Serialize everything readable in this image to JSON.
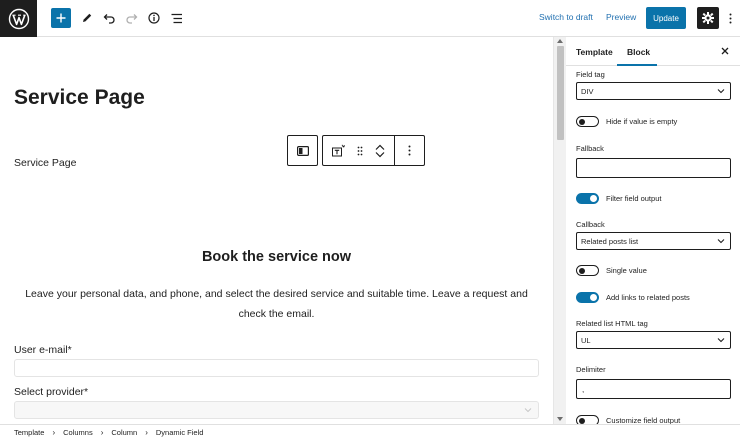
{
  "topbar": {
    "switch_to_draft": "Switch to draft",
    "preview": "Preview",
    "update": "Update",
    "icons": [
      "wordpress-logo",
      "plus-icon",
      "pencil-icon",
      "undo-icon",
      "redo-icon",
      "info-icon",
      "list-view-icon",
      "gear-icon",
      "more-vertical-icon"
    ]
  },
  "canvas": {
    "page_title": "Service Page",
    "service_text": "Service Page",
    "book_heading": "Book the service now",
    "book_desc": "Leave your personal data, and phone, and select the desired service and suitable time. Leave a request and check the email.",
    "email_label": "User e-mail*",
    "provider_label": "Select provider*"
  },
  "sidebar": {
    "tabs": [
      "Template",
      "Block"
    ],
    "field_tag_label": "Field tag",
    "field_tag_value": "DIV",
    "hide_if_empty": "Hide if value is empty",
    "fallback_label": "Fallback",
    "fallback_value": "",
    "filter_output": "Filter field output",
    "callback_label": "Callback",
    "callback_value": "Related posts list",
    "single_value": "Single value",
    "add_links": "Add links to related posts",
    "html_tag_label": "Related list HTML tag",
    "html_tag_value": "UL",
    "delimiter_label": "Delimiter",
    "delimiter_value": ",",
    "customize_output": "Customize field output",
    "toggles": {
      "hide_if_empty": false,
      "filter_output": true,
      "single_value": false,
      "add_links": true,
      "customize_output": false
    }
  },
  "breadcrumb": [
    "Template",
    "Columns",
    "Column",
    "Dynamic Field"
  ],
  "colors": {
    "accent": "#0a73aa",
    "dark": "#1e1e1e",
    "link": "#2271b1"
  }
}
